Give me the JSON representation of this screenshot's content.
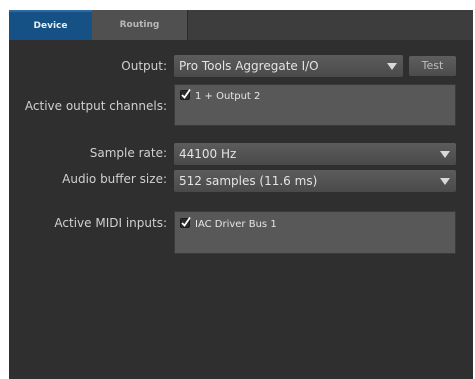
{
  "tabs": [
    {
      "label": "Device",
      "active": true
    },
    {
      "label": "Routing",
      "active": false
    }
  ],
  "output": {
    "label": "Output:",
    "value": "Pro Tools Aggregate I/O",
    "test_label": "Test"
  },
  "active_output_channels": {
    "label": "Active output channels:",
    "items": [
      {
        "label": "1 + Output 2",
        "checked": true
      }
    ]
  },
  "sample_rate": {
    "label": "Sample rate:",
    "value": "44100 Hz"
  },
  "buffer_size": {
    "label": "Audio buffer size:",
    "value": "512 samples (11.6 ms)"
  },
  "midi_inputs": {
    "label": "Active MIDI inputs:",
    "items": [
      {
        "label": "IAC Driver Bus 1",
        "checked": true
      }
    ]
  },
  "colors": {
    "active_tab": "#165185",
    "panel_bg": "#2f2f2f",
    "control_bg": "#585858"
  }
}
